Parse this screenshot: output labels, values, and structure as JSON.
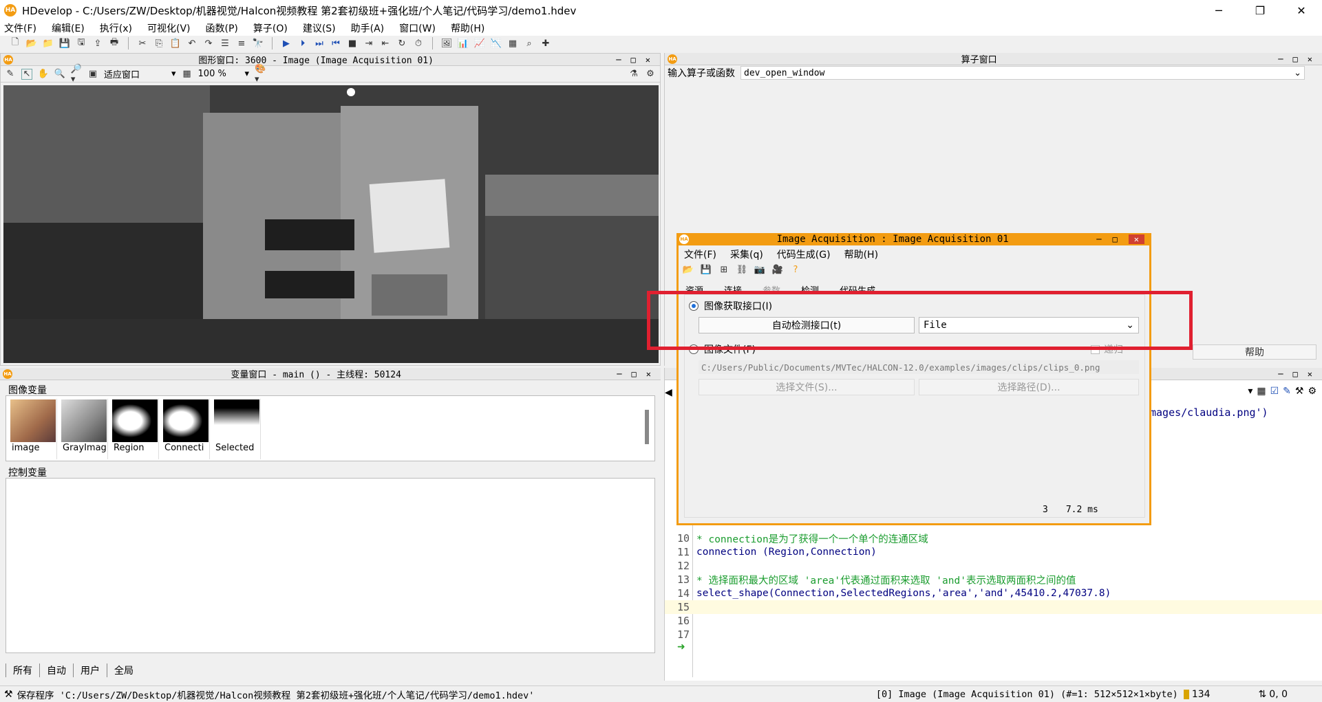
{
  "app": {
    "title": "HDevelop - C:/Users/ZW/Desktop/机器视觉/Halcon视频教程 第2套初级班+强化班/个人笔记/代码学习/demo1.hdev",
    "logo": "HA",
    "controls": {
      "minimize": "─",
      "maximize": "❐",
      "close": "✕"
    }
  },
  "menubar": [
    "文件(F)",
    "编辑(E)",
    "执行(x)",
    "可视化(V)",
    "函数(P)",
    "算子(O)",
    "建议(S)",
    "助手(A)",
    "窗口(W)",
    "帮助(H)"
  ],
  "graphics_window": {
    "title": "图形窗口: 3600 - Image (Image Acquisition 01)",
    "fit_label": "适应窗口",
    "zoom_label": "100 %"
  },
  "operator_window": {
    "title": "算子窗口",
    "input_label": "输入算子或函数",
    "input_value": "dev_open_window",
    "help_button": "帮助"
  },
  "variable_window": {
    "title": "变量窗口 - main () - 主线程: 50124",
    "image_vars_label": "图像变量",
    "control_vars_label": "控制变量",
    "thumbnails": [
      "image",
      "GrayImag",
      "Region",
      "Connecti",
      "Selected"
    ],
    "tabs": [
      "所有",
      "自动",
      "用户",
      "全局"
    ]
  },
  "program_window": {
    "partial_line": "mages/claudia.png')",
    "lines": [
      {
        "n": "10",
        "text": "* connection是为了获得一个一个单个的连通区域",
        "kind": "comment"
      },
      {
        "n": "11",
        "text": "connection (Region,Connection)",
        "kind": "code"
      },
      {
        "n": "12",
        "text": "",
        "kind": "code"
      },
      {
        "n": "13",
        "text": "* 选择面积最大的区域 'area'代表通过面积来选取 'and'表示选取两面积之间的值",
        "kind": "comment"
      },
      {
        "n": "14",
        "text": "select_shape(Connection,SelectedRegions,'area','and',45410.2,47037.8)",
        "kind": "code"
      },
      {
        "n": "15",
        "text": "",
        "kind": "code"
      },
      {
        "n": "16",
        "text": "",
        "kind": "code"
      },
      {
        "n": "17",
        "text": "",
        "kind": "code"
      }
    ]
  },
  "acquisition_dialog": {
    "title": "Image Acquisition : Image Acquisition 01",
    "menu": [
      "文件(F)",
      "采集(q)",
      "代码生成(G)",
      "帮助(H)"
    ],
    "tabs": [
      "资源",
      "连接",
      "参数",
      "检测",
      "代码生成"
    ],
    "interface_radio": "图像获取接口(I)",
    "autodetect_button": "自动检测接口(t)",
    "interface_value": "File",
    "file_radio": "图像文件(F)",
    "recursive_label": "递归",
    "file_path": "C:/Users/Public/Documents/MVTec/HALCON-12.0/examples/images/clips/clips_0.png",
    "select_file_button": "选择文件(S)...",
    "select_path_button": "选择路径(D)...",
    "status_count": "3",
    "status_time": "7.2 ms"
  },
  "statusbar": {
    "left": "保存程序 'C:/Users/ZW/Desktop/机器视觉/Halcon视频教程 第2套初级班+强化班/个人笔记/代码学习/demo1.hdev'",
    "image_info": "[0] Image (Image Acquisition 01) (#=1: 512×512×1×byte)",
    "gray_value": "134",
    "coords": "0, 0"
  },
  "colors": {
    "accent": "#f39c12",
    "highlight": "#e02030",
    "comment": "#1a9c2e"
  }
}
